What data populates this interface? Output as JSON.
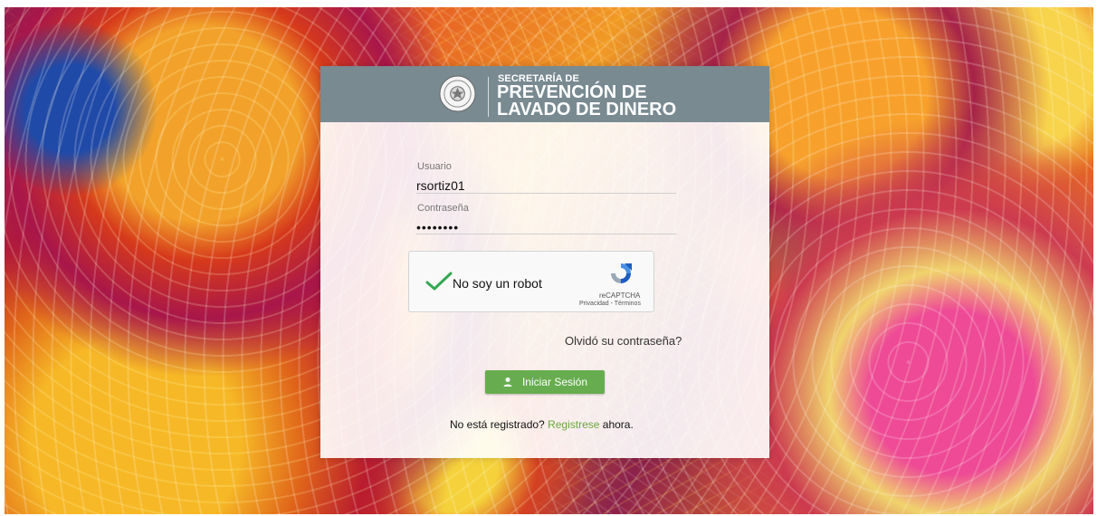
{
  "header": {
    "small_title": "SECRETARÍA DE",
    "line1": "PREVENCIÓN DE",
    "line2": "LAVADO DE DINERO"
  },
  "form": {
    "user_label": "Usuario",
    "user_value": "rsortiz01",
    "password_label": "Contraseña",
    "password_value": "••••••••"
  },
  "captcha": {
    "label": "No soy un robot",
    "brand": "reCAPTCHA",
    "links": "Privacidad - Términos"
  },
  "links": {
    "forgot_password": "Olvidó su contraseña?"
  },
  "actions": {
    "login_label": "Iniciar Sesión"
  },
  "register": {
    "prefix": "No está registrado?",
    "link": "Registrese",
    "suffix": "ahora."
  },
  "colors": {
    "header_bg": "#798a91",
    "button_green": "#67ad4f",
    "link_green": "#6aa53e"
  },
  "icons": {
    "seal": "national-seal-icon",
    "check": "check-icon",
    "recaptcha": "recaptcha-icon",
    "user": "user-icon"
  }
}
